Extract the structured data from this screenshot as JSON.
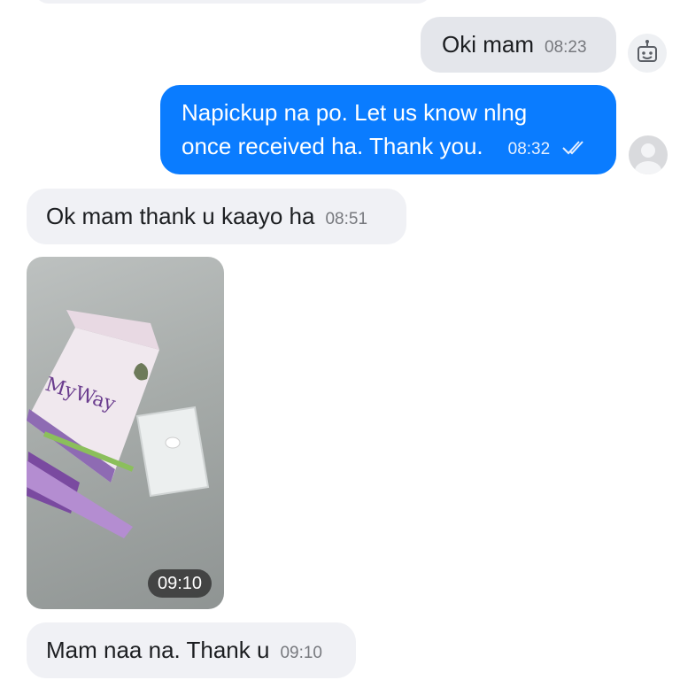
{
  "messages": [
    {
      "text": "Oki mam",
      "time": "08:23"
    },
    {
      "line1": "Napickup na po. Let us know nlng",
      "line2": "once received ha. Thank you.",
      "time": "08:32"
    },
    {
      "text": "Ok mam thank u kaayo ha",
      "time": "08:51"
    },
    {
      "time": "09:10"
    },
    {
      "text": "Mam naa na. Thank u",
      "time": "09:10"
    }
  ],
  "icons": {
    "bot_icon": "robot-face-icon",
    "read_receipt": "double-check-icon",
    "seen_avatar": "default-avatar-icon"
  },
  "colors": {
    "sent_bubble": "#0a7cff",
    "sent_grey_bubble": "#e4e6eb",
    "received_bubble": "#f0f1f5"
  }
}
